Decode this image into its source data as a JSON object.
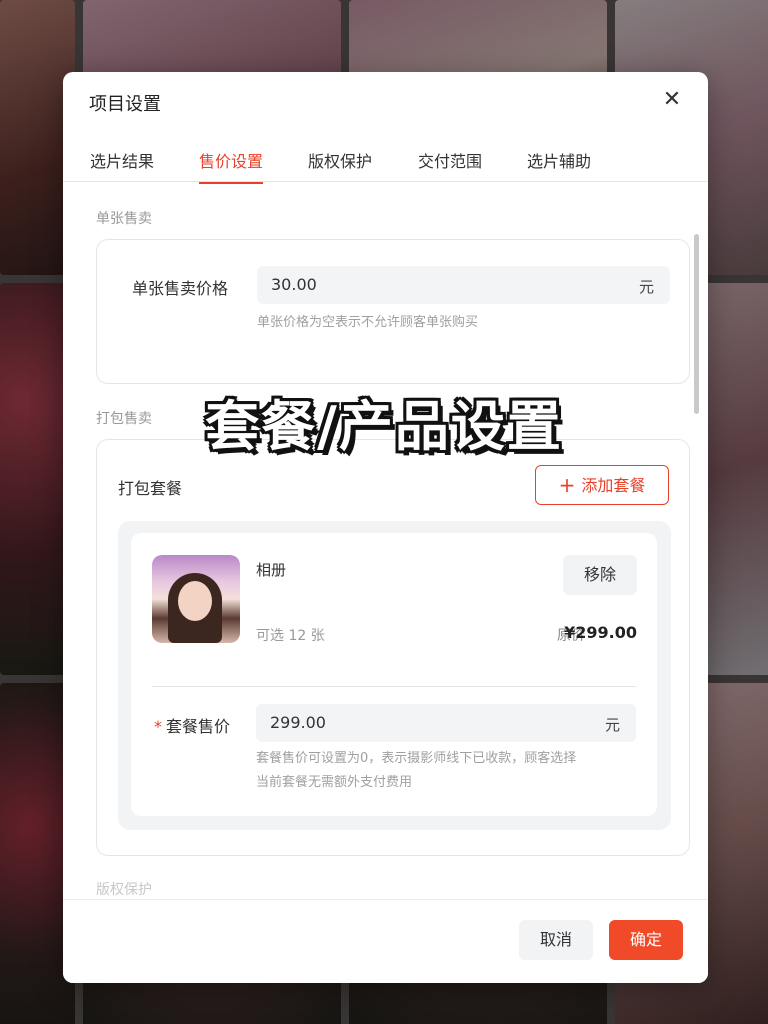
{
  "modal": {
    "title": "项目设置",
    "close_icon": "close-icon"
  },
  "tabs": [
    {
      "label": "选片结果",
      "active": false
    },
    {
      "label": "售价设置",
      "active": true
    },
    {
      "label": "版权保护",
      "active": false
    },
    {
      "label": "交付范围",
      "active": false
    },
    {
      "label": "选片辅助",
      "active": false
    }
  ],
  "single_sale": {
    "section_label": "单张售卖",
    "price_label": "单张售卖价格",
    "price_value": "30.00",
    "unit": "元",
    "hint": "单张价格为空表示不允许顾客单张购买"
  },
  "bundle_sale": {
    "section_label": "打包售卖",
    "title": "打包套餐",
    "add_button": "添加套餐",
    "package": {
      "name": "相册",
      "remove_button": "移除",
      "count_text": "可选 12 张",
      "orig_label": "原价",
      "orig_price": "¥299.00",
      "price_label": "套餐售价",
      "price_value": "299.00",
      "unit": "元",
      "hint_line1": "套餐售价可设置为0，表示摄影师线下已收款，顾客选择",
      "hint_line2": "当前套餐无需额外支付费用"
    }
  },
  "next_section_label": "版权保护",
  "footer": {
    "cancel": "取消",
    "confirm": "确定"
  },
  "overlay_caption": "套餐/产品设置",
  "colors": {
    "accent": "#e8412a",
    "confirm_bg": "#f04a28"
  }
}
